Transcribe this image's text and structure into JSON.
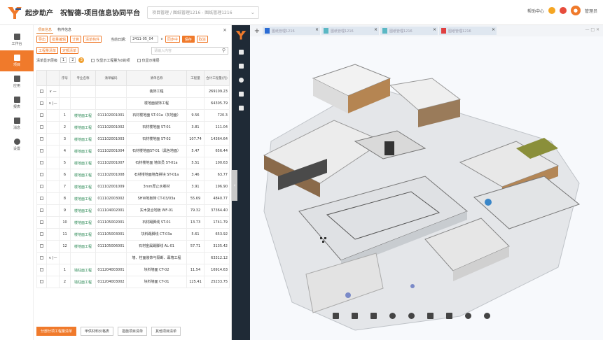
{
  "header": {
    "brand": "起步助产",
    "platform_title": "祝智德-项目信息协同平台",
    "crumb": "项目管理 / 图纸管理1216 - 图纸管理1216",
    "right_items": [
      "帮助中心"
    ],
    "user": "管理员"
  },
  "sidebar": {
    "items": [
      {
        "label": "工作台",
        "icon": "desktop-icon",
        "active": false
      },
      {
        "label": "项目",
        "icon": "building-icon",
        "active": true
      },
      {
        "label": "应用",
        "icon": "grid-icon",
        "active": false
      },
      {
        "label": "报表",
        "icon": "report-icon",
        "active": false
      },
      {
        "label": "消息",
        "icon": "message-icon",
        "active": false
      },
      {
        "label": "设置",
        "icon": "gear-icon",
        "active": false
      }
    ]
  },
  "panel": {
    "tabs": [
      "项目信息",
      "构件信息"
    ],
    "buttons": [
      "导出",
      "批量编辑",
      "计算",
      "清单构件"
    ],
    "date_label": "当前日期：",
    "date_value": "2411-05_04",
    "right_buttons": [
      "同步中",
      "保存",
      "取消"
    ],
    "sub_buttons": [
      "工程量清单",
      "定额清单"
    ],
    "search_placeholder": "请输入内容",
    "pager_label": "清单显示层级",
    "pager_pages": [
      "1",
      "2"
    ],
    "pager_current": "3",
    "checkbox1": "仅显示工程量为0的项",
    "checkbox2": "仅显示楼层",
    "columns": [
      "序号",
      "专业名称",
      "清单编码",
      "清单名称",
      "工程量",
      "合计工程量(元)"
    ],
    "rows": [
      {
        "idx": "",
        "expand": "∨ —",
        "major": "",
        "code": "",
        "name": "装饰工程",
        "qty": "",
        "total": "269109.23"
      },
      {
        "idx": "",
        "expand": "∨ |—",
        "major": "",
        "code": "",
        "name": "楼地面装饰工程",
        "qty": "",
        "total": "64305.79"
      },
      {
        "idx": "1",
        "expand": "",
        "major": "楼地面工程",
        "code": "011102001001",
        "name": "石材楼地面 ST-01a（灰地面）",
        "qty": "9.56",
        "total": "720.3"
      },
      {
        "idx": "2",
        "expand": "",
        "major": "楼地面工程",
        "code": "011102001002",
        "name": "石材楼地面 ST-01",
        "qty": "3.81",
        "total": "111.04"
      },
      {
        "idx": "3",
        "expand": "",
        "major": "楼地面工程",
        "code": "011102001003",
        "name": "石材楼地面 ST-02",
        "qty": "107.74",
        "total": "14364.64"
      },
      {
        "idx": "4",
        "expand": "",
        "major": "楼地面工程",
        "code": "011102001004",
        "name": "石材楼地面ST-01（黑色地面）",
        "qty": "5.47",
        "total": "656.44"
      },
      {
        "idx": "5",
        "expand": "",
        "major": "楼地面工程",
        "code": "011102001007",
        "name": "石材楼地面 墙体员 ST-01a",
        "qty": "5.51",
        "total": "100.63"
      },
      {
        "idx": "6",
        "expand": "",
        "major": "楼地面工程",
        "code": "011102001008",
        "name": "石材楼地面墙角拼块 ST-01a",
        "qty": "3.46",
        "total": "63.77"
      },
      {
        "idx": "7",
        "expand": "",
        "major": "楼地面工程",
        "code": "011102001009",
        "name": "3mm厚止水卷材",
        "qty": "3.91",
        "total": "196.90"
      },
      {
        "idx": "8",
        "expand": "",
        "major": "楼地面工程",
        "code": "011102003002",
        "name": "SHW地板砖 CT-03/03a",
        "qty": "55.69",
        "total": "4840.77"
      },
      {
        "idx": "9",
        "expand": "",
        "major": "楼地面工程",
        "code": "011104002001",
        "name": "实木复合地板 WF-01",
        "qty": "79.32",
        "total": "37364.40"
      },
      {
        "idx": "10",
        "expand": "",
        "major": "楼地面工程",
        "code": "011105002001",
        "name": "石材踢脚线 ST-01",
        "qty": "13.73",
        "total": "1741.79"
      },
      {
        "idx": "11",
        "expand": "",
        "major": "楼地面工程",
        "code": "011105003001",
        "name": "块料踢脚线 CT-03a",
        "qty": "5.61",
        "total": "653.92"
      },
      {
        "idx": "12",
        "expand": "",
        "major": "楼地面工程",
        "code": "011105006001",
        "name": "石材金属踢脚线 AL-01",
        "qty": "57.71",
        "total": "3135.42"
      },
      {
        "idx": "",
        "expand": "∨ |—",
        "major": "",
        "code": "",
        "name": "墙、柱面装饰与隔断、幕墙工程",
        "qty": "",
        "total": "63312.12"
      },
      {
        "idx": "1",
        "expand": "",
        "major": "墙柱面工程",
        "code": "011204003001",
        "name": "块料墙面 CT-02",
        "qty": "11.54",
        "total": "16914.63"
      },
      {
        "idx": "2",
        "expand": "",
        "major": "墙柱面工程",
        "code": "011204003002",
        "name": "块料墙面 CT-01",
        "qty": "125.41",
        "total": "25233.75"
      }
    ],
    "footer_buttons": [
      "分部分项工程量清单",
      "甲供材料价格表",
      "措施项目清单",
      "其他项目清单"
    ]
  },
  "viewer": {
    "tabs": [
      "图纸管理1216",
      "图纸管理1216",
      "图纸管理1216",
      "图纸管理1216"
    ],
    "window_controls": "— □ ✕"
  }
}
